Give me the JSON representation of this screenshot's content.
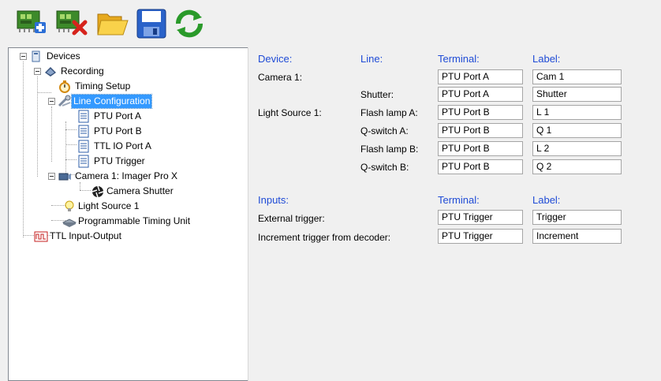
{
  "toolbar": {
    "buttons": [
      {
        "name": "add-device",
        "icon": "add-device-icon"
      },
      {
        "name": "remove-device",
        "icon": "remove-device-icon"
      },
      {
        "name": "open",
        "icon": "open-folder-icon"
      },
      {
        "name": "save",
        "icon": "save-disk-icon"
      },
      {
        "name": "refresh",
        "icon": "refresh-icon"
      }
    ]
  },
  "tree": {
    "devices": "Devices",
    "recording": "Recording",
    "timing_setup": "Timing Setup",
    "line_configuration": "Line Configuration",
    "ptu_port_a": "PTU Port A",
    "ptu_port_b": "PTU Port B",
    "ttl_io_port_a": "TTL IO Port A",
    "ptu_trigger": "PTU Trigger",
    "camera1": "Camera 1: Imager Pro X",
    "camera_shutter": "Camera Shutter",
    "light_source1": "Light Source 1",
    "ptu": "Programmable Timing Unit",
    "ttl_io": "TTL Input-Output"
  },
  "config": {
    "headers": {
      "device": "Device:",
      "line": "Line:",
      "terminal": "Terminal:",
      "label": "Label:"
    },
    "rows": [
      {
        "device": "Camera 1:",
        "line": "",
        "terminal": "PTU Port A",
        "label": "Cam 1"
      },
      {
        "device": "",
        "line": "Shutter:",
        "terminal": "PTU Port A",
        "label": "Shutter"
      },
      {
        "device": "Light Source 1:",
        "line": "Flash lamp A:",
        "terminal": "PTU Port B",
        "label": "L 1"
      },
      {
        "device": "",
        "line": "Q-switch A:",
        "terminal": "PTU Port B",
        "label": "Q 1"
      },
      {
        "device": "",
        "line": "Flash lamp B:",
        "terminal": "PTU Port B",
        "label": "L 2"
      },
      {
        "device": "",
        "line": "Q-switch B:",
        "terminal": "PTU Port B",
        "label": "Q 2"
      }
    ],
    "inputs_headers": {
      "inputs": "Inputs:",
      "terminal": "Terminal:",
      "label": "Label:"
    },
    "inputs": [
      {
        "name": "External trigger:",
        "terminal": "PTU Trigger",
        "label": "Trigger"
      },
      {
        "name": "Increment trigger from decoder:",
        "terminal": "PTU Trigger",
        "label": "Increment"
      }
    ]
  }
}
